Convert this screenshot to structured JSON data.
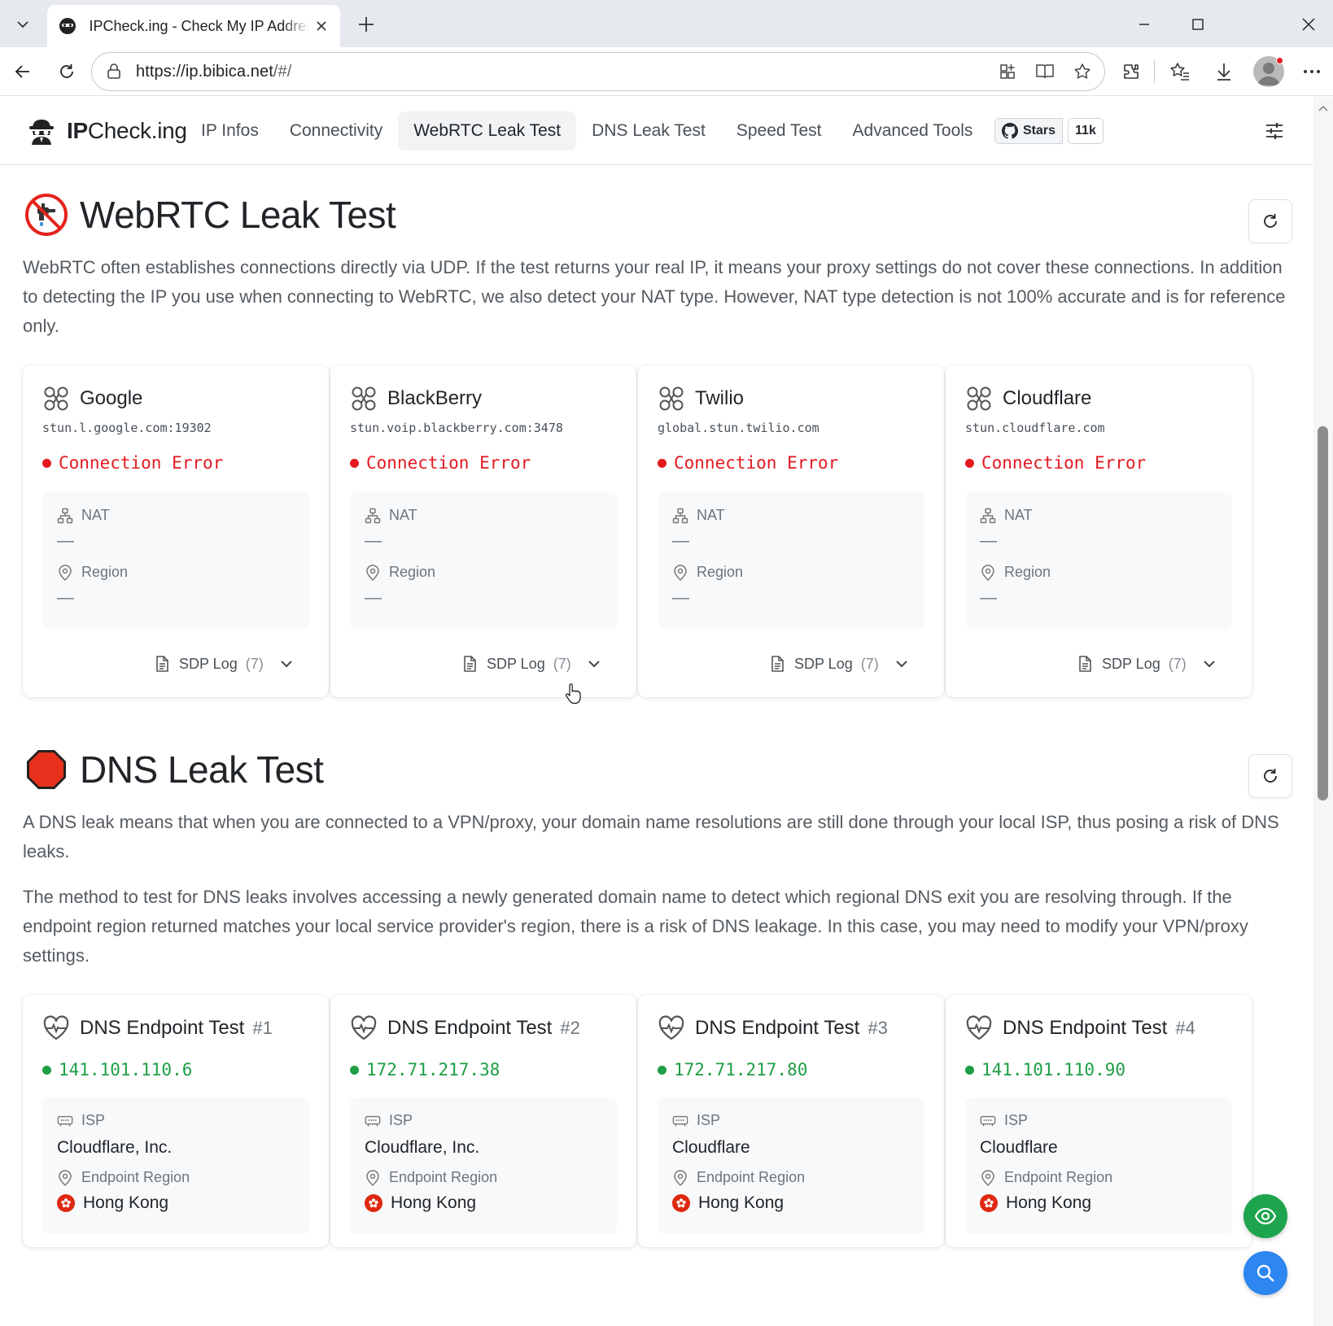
{
  "browser": {
    "tab_title": "IPCheck.ing - Check My IP Address",
    "url_host": "https://ip.bibica.net",
    "url_path": "/#/"
  },
  "nav": {
    "brand_bold": "IP",
    "brand_rest": "Check.ing",
    "links": [
      "IP Infos",
      "Connectivity",
      "WebRTC Leak Test",
      "DNS Leak Test",
      "Speed Test",
      "Advanced Tools"
    ],
    "github_label": "Stars",
    "github_count": "11k"
  },
  "webrtc": {
    "title": "WebRTC Leak Test",
    "description": "WebRTC often establishes connections directly via UDP. If the test returns your real IP, it means your proxy settings do not cover these connections. In addition to detecting the IP you use when connecting to WebRTC, we also detect your NAT type. However, NAT type detection is not 100% accurate and is for reference only.",
    "nat_label": "NAT",
    "region_label": "Region",
    "empty_value": "—",
    "sdp_label": "SDP Log",
    "cards": [
      {
        "name": "Google",
        "server": "stun.l.google.com:19302",
        "status": "Connection Error",
        "sdp_count": "(7)"
      },
      {
        "name": "BlackBerry",
        "server": "stun.voip.blackberry.com:3478",
        "status": "Connection Error",
        "sdp_count": "(7)"
      },
      {
        "name": "Twilio",
        "server": "global.stun.twilio.com",
        "status": "Connection Error",
        "sdp_count": "(7)"
      },
      {
        "name": "Cloudflare",
        "server": "stun.cloudflare.com",
        "status": "Connection Error",
        "sdp_count": "(7)"
      }
    ]
  },
  "dns": {
    "title": "DNS Leak Test",
    "description1": "A DNS leak means that when you are connected to a VPN/proxy, your domain name resolutions are still done through your local ISP, thus posing a risk of DNS leaks.",
    "description2": "The method to test for DNS leaks involves accessing a newly generated domain name to detect which regional DNS exit you are resolving through. If the endpoint region returned matches your local service provider's region, there is a risk of DNS leakage. In this case, you may need to modify your VPN/proxy settings.",
    "card_title": "DNS Endpoint Test",
    "isp_label": "ISP",
    "region_label": "Endpoint Region",
    "cards": [
      {
        "num": "#1",
        "ip": "141.101.110.6",
        "isp": "Cloudflare, Inc.",
        "region": "Hong Kong"
      },
      {
        "num": "#2",
        "ip": "172.71.217.38",
        "isp": "Cloudflare, Inc.",
        "region": "Hong Kong"
      },
      {
        "num": "#3",
        "ip": "172.71.217.80",
        "isp": "Cloudflare",
        "region": "Hong Kong"
      },
      {
        "num": "#4",
        "ip": "141.101.110.90",
        "isp": "Cloudflare",
        "region": "Hong Kong"
      }
    ]
  },
  "colors": {
    "error": "#e3191f",
    "success": "#1e9e45",
    "fab_eye": "#1ea44c",
    "fab_search": "#2e86f0"
  },
  "icons": {
    "webrtc_title": "no-faucet-icon",
    "dns_title": "stop-sign-icon",
    "stun_card": "network-nodes-icon",
    "dns_card": "heartbeat-icon",
    "nat": "sitemap-icon",
    "region": "map-pin-icon",
    "isp": "router-icon",
    "sdp": "document-icon"
  }
}
